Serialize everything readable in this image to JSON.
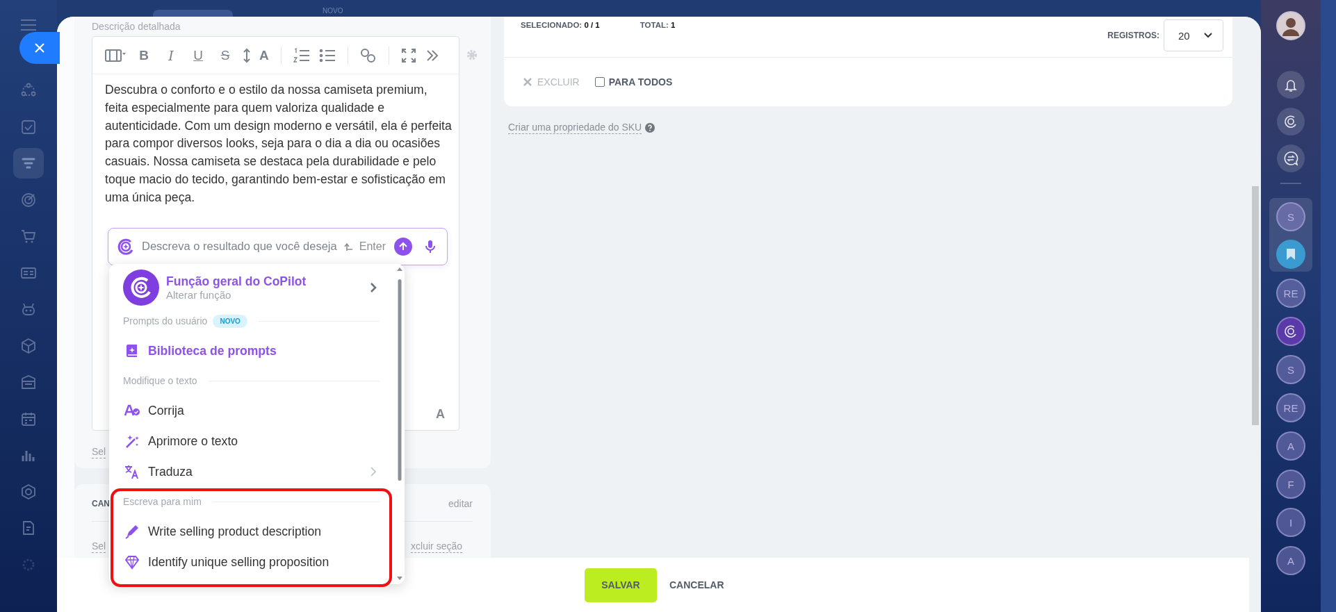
{
  "top_bar": {
    "badge": "NOVO"
  },
  "left_nav": [
    {
      "selected": false
    },
    {
      "selected": false
    },
    {
      "selected": true
    },
    {
      "selected": false
    },
    {
      "selected": false
    },
    {
      "selected": false
    },
    {
      "selected": false
    },
    {
      "selected": false
    },
    {
      "selected": false
    },
    {
      "selected": false
    },
    {
      "selected": false
    },
    {
      "selected": false
    },
    {
      "selected": false
    },
    {
      "selected": false
    }
  ],
  "description": {
    "label": "Descrição detalhada",
    "format_glyphs": [
      "B",
      "I",
      "U",
      "S",
      "A"
    ],
    "text": "Descubra o conforto e o estilo da nossa camiseta premium, feita especialmente para quem valoriza qualidade e autenticidade. Com um design moderno e versátil, ela é perfeita para compor diversos looks, seja para o dia a dia ou ocasiões casuais. Nossa camiseta se destaca pela durabilidade e pelo toque macio do tecido, garantindo bem-estar e sofisticação em uma única peça.",
    "corner_letter": "A",
    "below_link": "Sel"
  },
  "copilot_input": {
    "placeholder": "Descreva o resultado que você deseja",
    "hint": "Enter"
  },
  "copilot_menu": {
    "role_title": "Função geral do CoPilot",
    "role_subtitle": "Alterar função",
    "sections": [
      {
        "title": "Prompts do usuário",
        "badge": "NOVO",
        "highlighted": false,
        "items": [
          {
            "label": "Biblioteca de prompts",
            "kind": "library",
            "submenu": false
          }
        ]
      },
      {
        "title": "Modifique o texto",
        "highlighted": false,
        "items": [
          {
            "label": "Corrija",
            "kind": "spell",
            "submenu": false
          },
          {
            "label": "Aprimore o texto",
            "kind": "magic",
            "submenu": false
          },
          {
            "label": "Traduza",
            "kind": "translate",
            "submenu": true
          }
        ]
      },
      {
        "title": "Escreva para mim",
        "highlighted": true,
        "items": [
          {
            "label": "Write selling product description",
            "kind": "pen",
            "submenu": false
          },
          {
            "label": "Identify unique selling proposition",
            "kind": "diamond",
            "submenu": false
          }
        ]
      }
    ]
  },
  "section_card": {
    "title": "CAN",
    "edit_link": "editar",
    "left_link": "Sel",
    "right_link": "xcluir seção"
  },
  "grid_panel": {
    "selected_label": "SELECIONADO:",
    "selected_value": "0 / 1",
    "total_label": "TOTAL:",
    "total_value": "1",
    "page_size_label": "REGISTROS:",
    "page_size": "20",
    "delete_button": {
      "label": "EXCLUIR",
      "disabled": true
    },
    "for_all": {
      "label": "PARA TODOS",
      "checked": false
    }
  },
  "sku_link": "Criar uma propriedade do SKU",
  "footer": {
    "buttons": [
      {
        "label": "SALVAR",
        "kind": "primary"
      },
      {
        "label": "CANCELAR",
        "kind": "link"
      }
    ]
  },
  "chats": [
    {
      "kind": "letter",
      "text": "S",
      "pinned": true
    },
    {
      "kind": "saved",
      "pinned": true
    },
    {
      "kind": "letter",
      "text": "RE",
      "pinned": false
    },
    {
      "kind": "copilot",
      "pinned": false
    },
    {
      "kind": "letter",
      "text": "S",
      "pinned": false
    },
    {
      "kind": "letter",
      "text": "RE",
      "pinned": false
    },
    {
      "kind": "letter",
      "text": "A",
      "pinned": false
    },
    {
      "kind": "letter",
      "text": "F",
      "pinned": false
    },
    {
      "kind": "letter",
      "text": "I",
      "pinned": false
    },
    {
      "kind": "letter",
      "text": "A",
      "pinned": false
    }
  ]
}
